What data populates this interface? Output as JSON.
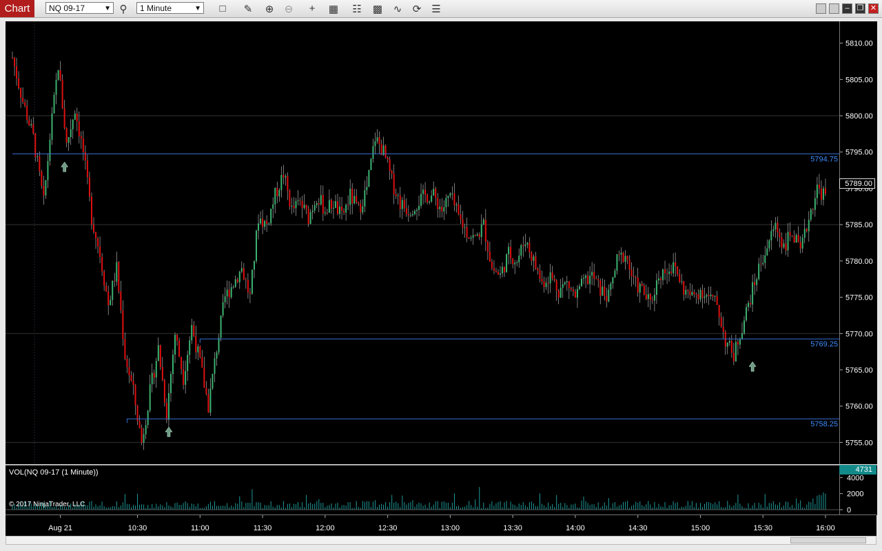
{
  "toolbar": {
    "tab_label": "Chart",
    "instrument": "NQ 09-17",
    "interval": "1 Minute",
    "icons": [
      "search-icon",
      "square-icon",
      "pencil-icon",
      "zoom-in-icon",
      "zoom-out-icon",
      "crosshair-icon",
      "data-box-icon",
      "bar-spacing-icon",
      "strategies-icon",
      "indicators-icon",
      "refresh-icon",
      "list-icon"
    ]
  },
  "window_controls": [
    "minimize-icon",
    "restore-icon",
    "close-icon"
  ],
  "price_axis": {
    "ticks": [
      "5810.00",
      "5805.00",
      "5800.00",
      "5795.00",
      "5790.00",
      "5785.00",
      "5780.00",
      "5775.00",
      "5770.00",
      "5765.00",
      "5760.00",
      "5755.00"
    ],
    "last_price": "5789.00"
  },
  "horizontal_lines": [
    {
      "price": 5794.75,
      "label": "5794.75",
      "start_time": "09:30"
    },
    {
      "price": 5769.25,
      "label": "5769.25",
      "start_time": "11:00"
    },
    {
      "price": 5758.25,
      "label": "5758.25",
      "start_time": "10:25"
    }
  ],
  "buy_arrows": [
    {
      "time": "09:55",
      "price": 5794.0
    },
    {
      "time": "10:45",
      "price": 5757.5
    },
    {
      "time": "15:25",
      "price": 5766.5
    }
  ],
  "volume_panel": {
    "title": "VOL(NQ 09-17 (1 Minute))",
    "copyright": "© 2017 NinjaTrader, LLC",
    "ticks": [
      "4000",
      "2000",
      "0"
    ],
    "last_volume": "4731"
  },
  "time_axis": {
    "labels": [
      "Aug 21",
      "10:30",
      "11:00",
      "11:30",
      "12:00",
      "12:30",
      "13:00",
      "13:30",
      "14:00",
      "14:30",
      "15:00",
      "15:30",
      "16:00"
    ]
  },
  "chart_data": {
    "type": "candlestick",
    "instrument": "NQ 09-17",
    "interval": "1 Minute",
    "x_range": [
      "09:30",
      "16:00"
    ],
    "ylim": [
      5752,
      5813
    ],
    "up_color": "#3cb371",
    "down_color": "#e01010",
    "line_color": "#3a6fd8",
    "close_path": [
      [
        "09:30",
        5808
      ],
      [
        "09:35",
        5802
      ],
      [
        "09:40",
        5797
      ],
      [
        "09:45",
        5788
      ],
      [
        "09:48",
        5797
      ],
      [
        "09:52",
        5807
      ],
      [
        "09:56",
        5796
      ],
      [
        "10:00",
        5801
      ],
      [
        "10:04",
        5795
      ],
      [
        "10:08",
        5786
      ],
      [
        "10:12",
        5781
      ],
      [
        "10:16",
        5774
      ],
      [
        "10:20",
        5779
      ],
      [
        "10:24",
        5767
      ],
      [
        "10:28",
        5762
      ],
      [
        "10:32",
        5755
      ],
      [
        "10:36",
        5762
      ],
      [
        "10:40",
        5768
      ],
      [
        "10:44",
        5759
      ],
      [
        "10:48",
        5770
      ],
      [
        "10:52",
        5764
      ],
      [
        "10:56",
        5771
      ],
      [
        "11:00",
        5766
      ],
      [
        "11:04",
        5760
      ],
      [
        "11:08",
        5768
      ],
      [
        "11:12",
        5775
      ],
      [
        "11:16",
        5777
      ],
      [
        "11:20",
        5779
      ],
      [
        "11:24",
        5775
      ],
      [
        "11:28",
        5786
      ],
      [
        "11:32",
        5785
      ],
      [
        "11:36",
        5789
      ],
      [
        "11:40",
        5792
      ],
      [
        "11:44",
        5787
      ],
      [
        "11:48",
        5788
      ],
      [
        "11:52",
        5786
      ],
      [
        "11:56",
        5789
      ],
      [
        "12:00",
        5787
      ],
      [
        "12:04",
        5788
      ],
      [
        "12:08",
        5786
      ],
      [
        "12:12",
        5789
      ],
      [
        "12:16",
        5787
      ],
      [
        "12:20",
        5790
      ],
      [
        "12:24",
        5797
      ],
      [
        "12:28",
        5795
      ],
      [
        "12:32",
        5791
      ],
      [
        "12:36",
        5788
      ],
      [
        "12:40",
        5787
      ],
      [
        "12:44",
        5788
      ],
      [
        "12:48",
        5789
      ],
      [
        "12:52",
        5789
      ],
      [
        "12:56",
        5787
      ],
      [
        "13:00",
        5789
      ],
      [
        "13:04",
        5786
      ],
      [
        "13:08",
        5784
      ],
      [
        "13:12",
        5783
      ],
      [
        "13:16",
        5785
      ],
      [
        "13:20",
        5779
      ],
      [
        "13:24",
        5778
      ],
      [
        "13:28",
        5781
      ],
      [
        "13:32",
        5780
      ],
      [
        "13:36",
        5783
      ],
      [
        "13:40",
        5780
      ],
      [
        "13:44",
        5777
      ],
      [
        "13:48",
        5778
      ],
      [
        "13:52",
        5776
      ],
      [
        "13:56",
        5777
      ],
      [
        "14:00",
        5775
      ],
      [
        "14:04",
        5777
      ],
      [
        "14:08",
        5778
      ],
      [
        "14:12",
        5776
      ],
      [
        "14:16",
        5775
      ],
      [
        "14:20",
        5780
      ],
      [
        "14:24",
        5781
      ],
      [
        "14:28",
        5777
      ],
      [
        "14:32",
        5776
      ],
      [
        "14:36",
        5774
      ],
      [
        "14:40",
        5778
      ],
      [
        "14:44",
        5779
      ],
      [
        "14:48",
        5779
      ],
      [
        "14:52",
        5776
      ],
      [
        "14:56",
        5775
      ],
      [
        "15:00",
        5776
      ],
      [
        "15:04",
        5775
      ],
      [
        "15:08",
        5774
      ],
      [
        "15:12",
        5769
      ],
      [
        "15:16",
        5767
      ],
      [
        "15:20",
        5771
      ],
      [
        "15:24",
        5775
      ],
      [
        "15:28",
        5779
      ],
      [
        "15:32",
        5782
      ],
      [
        "15:36",
        5785
      ],
      [
        "15:40",
        5782
      ],
      [
        "15:44",
        5784
      ],
      [
        "15:48",
        5781
      ],
      [
        "15:52",
        5786
      ],
      [
        "15:56",
        5790
      ],
      [
        "16:00",
        5789
      ]
    ],
    "volume_ylim": [
      0,
      4800
    ]
  }
}
